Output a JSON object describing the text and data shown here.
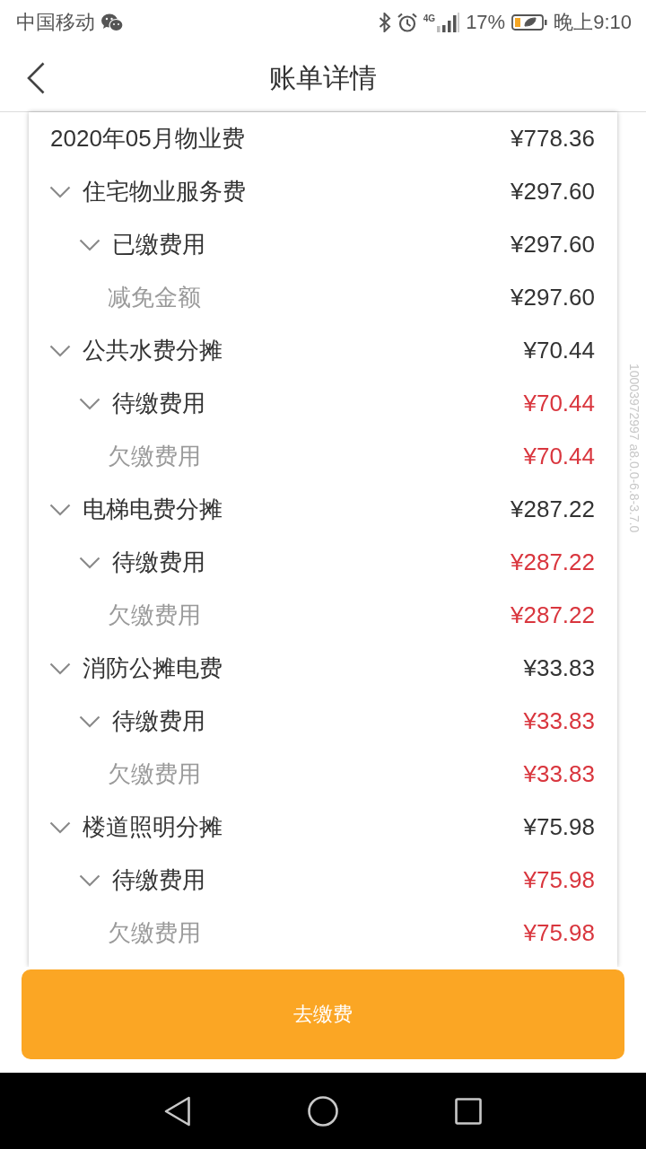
{
  "status_bar": {
    "carrier": "中国移动",
    "network": "4G",
    "battery": "17%",
    "time": "晚上9:10"
  },
  "header": {
    "title": "账单详情"
  },
  "bill": {
    "title": "2020年05月物业费",
    "amount": "¥778.36",
    "items": [
      {
        "label": "住宅物业服务费",
        "amount": "¥297.60",
        "unpaid": false,
        "expanded": true,
        "children": [
          {
            "label": "已缴费用",
            "amount": "¥297.60",
            "unpaid": false,
            "expanded": true,
            "children": [
              {
                "label": "减免金额",
                "amount": "¥297.60",
                "unpaid": false
              }
            ]
          }
        ]
      },
      {
        "label": "公共水费分摊",
        "amount": "¥70.44",
        "unpaid": false,
        "expanded": true,
        "children": [
          {
            "label": "待缴费用",
            "amount": "¥70.44",
            "unpaid": true,
            "expanded": true,
            "children": [
              {
                "label": "欠缴费用",
                "amount": "¥70.44",
                "unpaid": true
              }
            ]
          }
        ]
      },
      {
        "label": "电梯电费分摊",
        "amount": "¥287.22",
        "unpaid": false,
        "expanded": true,
        "children": [
          {
            "label": "待缴费用",
            "amount": "¥287.22",
            "unpaid": true,
            "expanded": true,
            "children": [
              {
                "label": "欠缴费用",
                "amount": "¥287.22",
                "unpaid": true
              }
            ]
          }
        ]
      },
      {
        "label": "消防公摊电费",
        "amount": "¥33.83",
        "unpaid": false,
        "expanded": true,
        "children": [
          {
            "label": "待缴费用",
            "amount": "¥33.83",
            "unpaid": true,
            "expanded": true,
            "children": [
              {
                "label": "欠缴费用",
                "amount": "¥33.83",
                "unpaid": true
              }
            ]
          }
        ]
      },
      {
        "label": "楼道照明分摊",
        "amount": "¥75.98",
        "unpaid": false,
        "expanded": true,
        "children": [
          {
            "label": "待缴费用",
            "amount": "¥75.98",
            "unpaid": true,
            "expanded": true,
            "children": [
              {
                "label": "欠缴费用",
                "amount": "¥75.98",
                "unpaid": true
              }
            ]
          }
        ]
      }
    ]
  },
  "version_label": "10003972997 a8.0.0-6.8-3.7.0",
  "pay_button": {
    "label": "去缴费"
  }
}
